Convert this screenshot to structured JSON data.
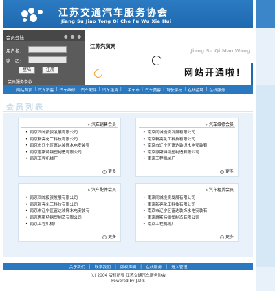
{
  "header": {
    "title": "江苏交通汽车服务协会",
    "subtitle": "Jiang Su Jiao Tong Qi Che Fu Wu Xie Hui"
  },
  "login": {
    "title": "会员登陆",
    "dots": "● ● ●",
    "user_label": "用户名：",
    "pass_label": "密　码：",
    "login_button": "登陆",
    "register_button": "注册",
    "note": "会员服务条款"
  },
  "banner": {
    "small_text": "江苏汽贸网",
    "pinyin": "Jiang Su Qi Mao Wang",
    "headline": "网站开通啦！"
  },
  "nav": {
    "items": [
      "网站首页",
      "汽车销售",
      "汽车维修",
      "汽车配件",
      "汽车租赁",
      "二手车市",
      "汽车美容",
      "驾驶学校",
      "在线招聘",
      "在线服务"
    ]
  },
  "section_title": "会员列表",
  "cards": [
    {
      "title": "汽车销售会员",
      "companies": [
        "南京同城投资发展有限公司",
        "南京新亮化工科技有限公司",
        "南京市辽宁区富达装饰水电安装有",
        "南京惠斯特钢塑制造有限公司",
        "南京工程机械厂"
      ],
      "more": "更多"
    },
    {
      "title": "汽车维修会员",
      "companies": [
        "南京同城投资发展有限公司",
        "南京新亮化工科技有限公司",
        "南京市辽宁区富达装饰水电安装有",
        "南京惠斯特钢塑制造有限公司",
        "南京工程机械厂"
      ],
      "more": "更多"
    },
    {
      "title": "汽车配件会员",
      "companies": [
        "南京同城投资发展有限公司",
        "南京新亮化工科技有限公司",
        "南京市辽宁区富达装饰水电安装有",
        "南京惠斯特钢塑制造有限公司",
        "南京工程机械厂"
      ],
      "more": "更多"
    },
    {
      "title": "汽车租赁会员",
      "companies": [
        "南京同城投资发展有限公司",
        "南京新亮化工科技有限公司",
        "南京市辽宁区富达装饰水电安装有",
        "南京惠斯特钢塑制造有限公司",
        "南京工程机械厂"
      ],
      "more": "更多"
    }
  ],
  "footer": {
    "links": [
      "关于我们",
      "联系我们",
      "版权声明",
      "在线服务",
      "进入管理"
    ],
    "copyright": "(c) 2004 版权所有 江苏交通汽车服务协会",
    "powered": "Powered by J.D.S"
  }
}
